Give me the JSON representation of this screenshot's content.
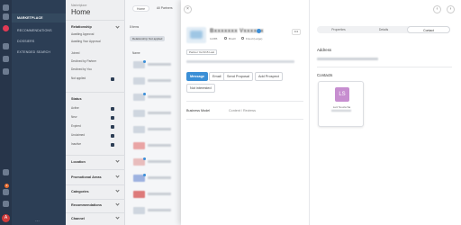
{
  "rail": {
    "badge_count": "9",
    "avatar_letter": "A"
  },
  "nav": {
    "items": [
      {
        "label": "MARKETPLACE"
      },
      {
        "label": "RECOMMENDATIONS"
      },
      {
        "label": "DOSSIERS"
      },
      {
        "label": "EXTENDED SEARCH"
      }
    ],
    "more": "…"
  },
  "filters": {
    "breadcrumb": "Marketplace",
    "title": "Home",
    "sections": {
      "relationship": {
        "label": "Relationship",
        "options": [
          "Awaiting Approval",
          "Awaiting Your Approval",
          "Joined",
          "Declined by Partner",
          "Declined by You",
          "Not applied"
        ]
      },
      "status": {
        "label": "Status",
        "options": [
          "Active",
          "New",
          "Expired",
          "Unclaimed",
          "Inactive"
        ]
      },
      "location": "Location",
      "promotional_areas": "Promotional Areas",
      "categories": "Categories",
      "recommendations": "Recommendations",
      "channel": "Channel"
    }
  },
  "list": {
    "tabs": [
      "Home",
      "All Partners"
    ],
    "count": "8 items",
    "chip": "Relationship: Not applied",
    "column": "Name"
  },
  "detail": {
    "company_name": "Bxxxxxxx Vxxxxxx",
    "meta": {
      "id": "11385",
      "region": "Brazil",
      "tier": "Fixed (Large)"
    },
    "more_label": "•••",
    "tag": "Partner Yet 6/15 Last",
    "actions": {
      "message": "Message",
      "email": "Email",
      "send_proposal": "Send Proposal",
      "add_prospect": "Add Prospect",
      "not_interested": "Not interested"
    },
    "business_model_label": "Business Model",
    "business_model_value": "Content / Reviews",
    "tabs": [
      "Properties",
      "Details",
      "Contact"
    ],
    "active_tab": "Contact",
    "address_label": "Address",
    "contacts_label": "Contacts",
    "contact": {
      "initials": "LS",
      "name": "Luiz Souza Sa"
    },
    "close_symbol": "×",
    "prev_symbol": "‹",
    "next_symbol": "›"
  }
}
